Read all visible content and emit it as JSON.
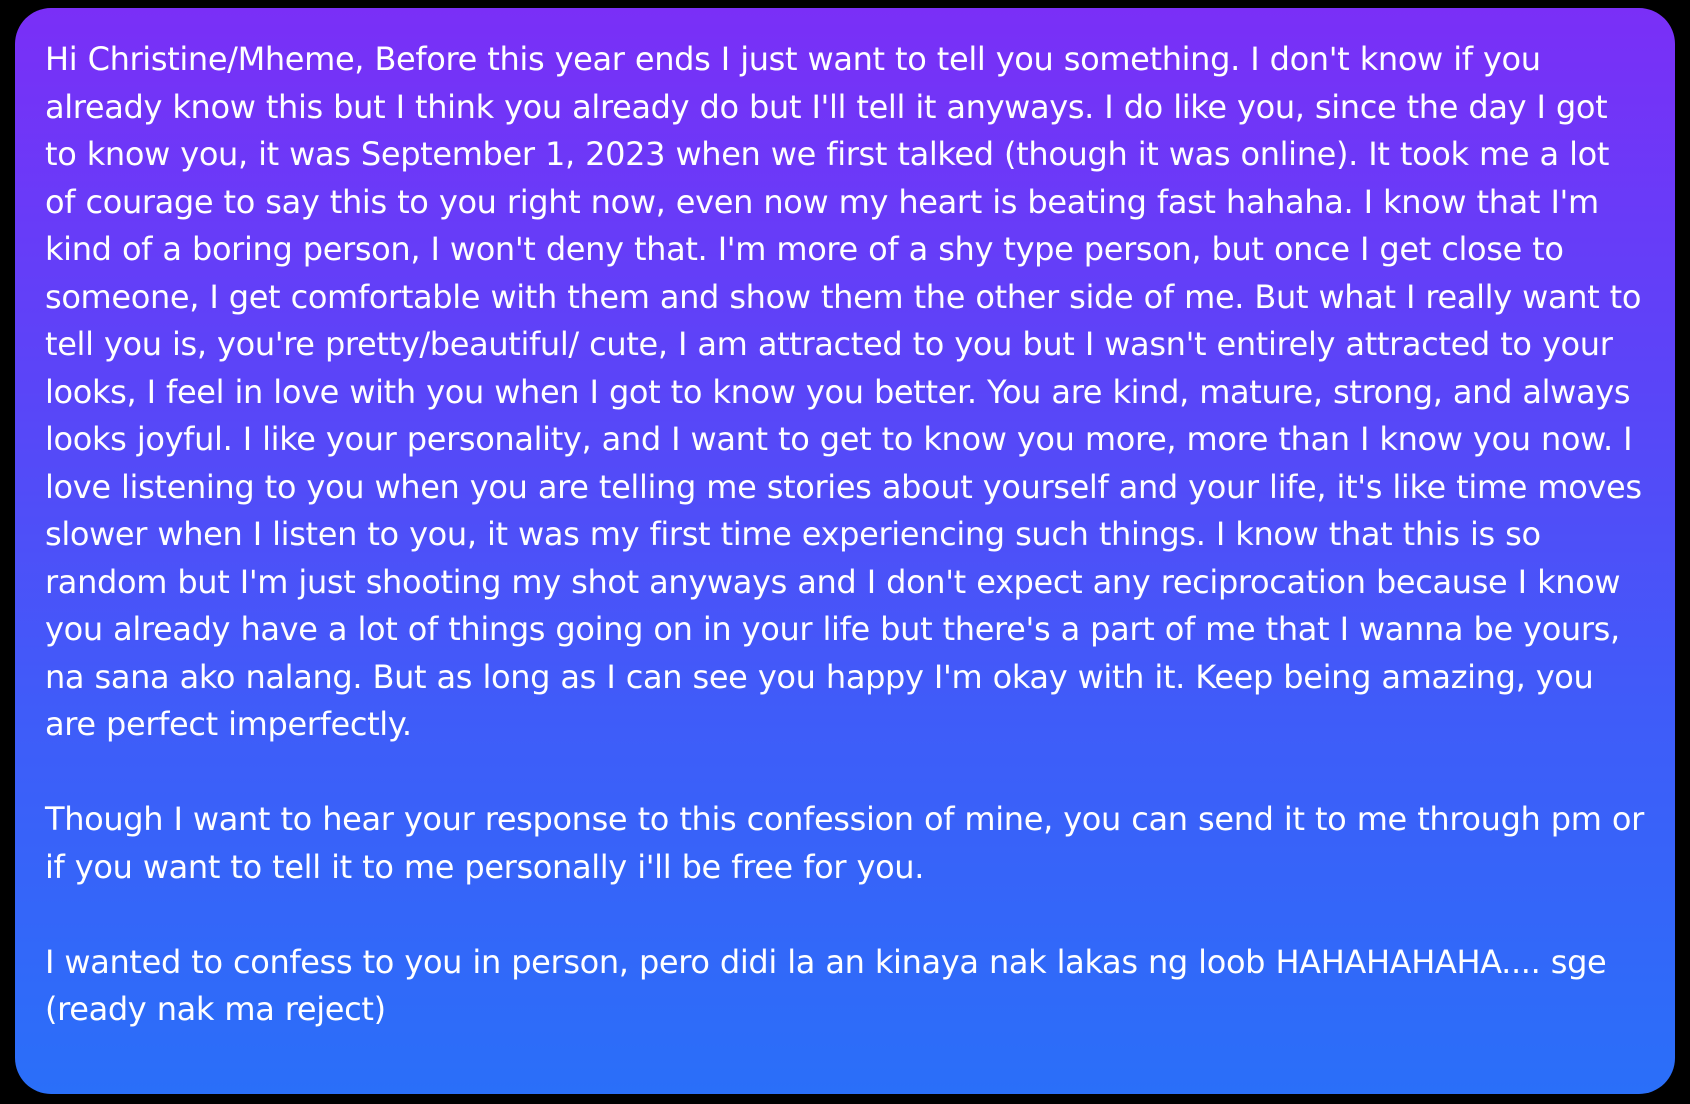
{
  "message": {
    "paragraphs": [
      "Hi Christine/Mheme, Before this year ends I just want to tell you something. I don't know if you already know this but I think you already do but I'll tell it anyways. I do like you, since the day I got to know you, it was September 1, 2023 when we first talked (though it was online). It took me a lot of courage to say this to you right now, even now my heart is beating fast hahaha. I know that I'm kind of a boring person, I won't deny that. I'm more of a shy type person, but once I get close to someone, I get comfortable with them and show them the other side of me. But what I really want to tell you is, you're pretty/beautiful/ cute, I am attracted to you but I wasn't entirely attracted to your looks, I feel in love with you when I got to know you better. You are kind, mature, strong, and always looks joyful. I like your personality, and I want to get to know you more, more than I know you now. I love listening to you when you are telling me stories about yourself and your life, it's like time moves slower when I listen to you, it was my first time experiencing such things. I know that this is so random but I'm just shooting my shot anyways and I don't expect any reciprocation because I know you already have a lot of things going on in your life but there's a part of me that I wanna be yours, na sana ako nalang. But as long as I can see you happy I'm okay with it. Keep being amazing, you are perfect imperfectly.",
      "Though I want to hear your response to this confession of mine, you can send it to me through pm or if you want to tell it  to me personally i'll be free for you.",
      "I wanted to confess to you in person, pero didi la an kinaya nak lakas ng loob HAHAHAHAHA.... sge (ready nak ma reject)"
    ]
  },
  "colors": {
    "background": "#000000",
    "bubble_gradient_top": "#7a2ff7",
    "bubble_gradient_bottom": "#2a6ff9",
    "text": "#ffffff"
  }
}
